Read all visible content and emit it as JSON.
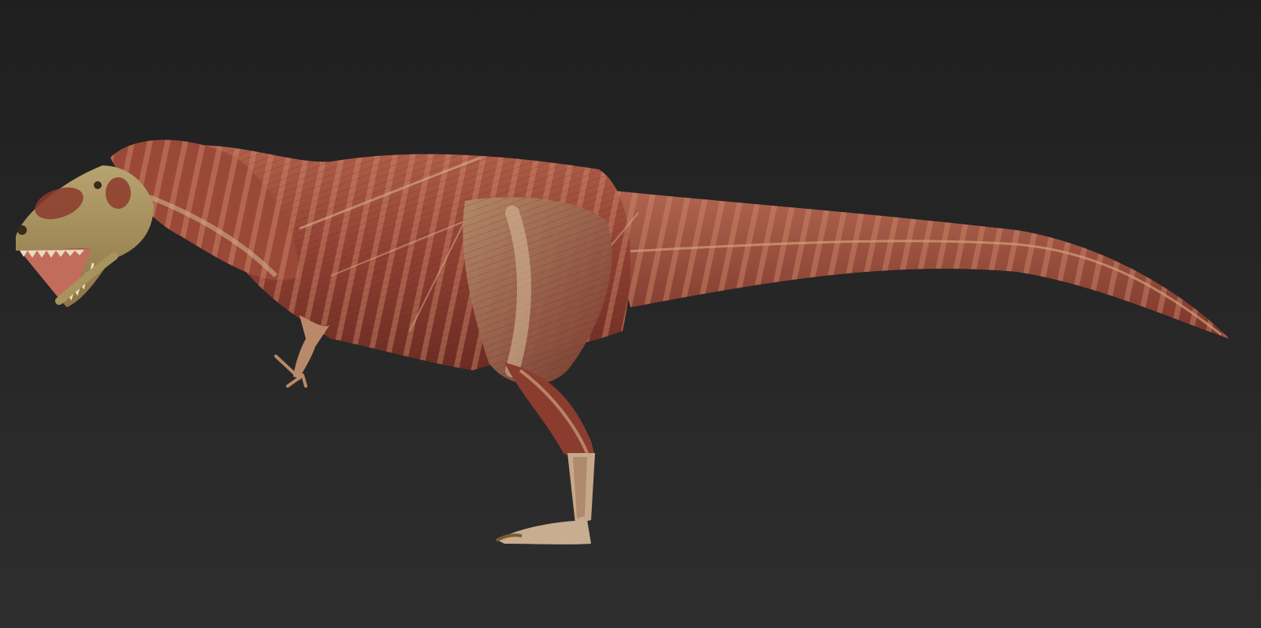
{
  "scene": {
    "subject": "dinosaur-muscle-anatomy-render",
    "background": "#2a2a2a",
    "colors": {
      "muscle_dark": "#6e2f24",
      "muscle_mid": "#9a4a38",
      "muscle_light": "#b86a52",
      "tendon": "#c9a27c",
      "bone": "#c9b48a",
      "skull": "#a8935c",
      "teeth": "#e8dcc0"
    }
  }
}
